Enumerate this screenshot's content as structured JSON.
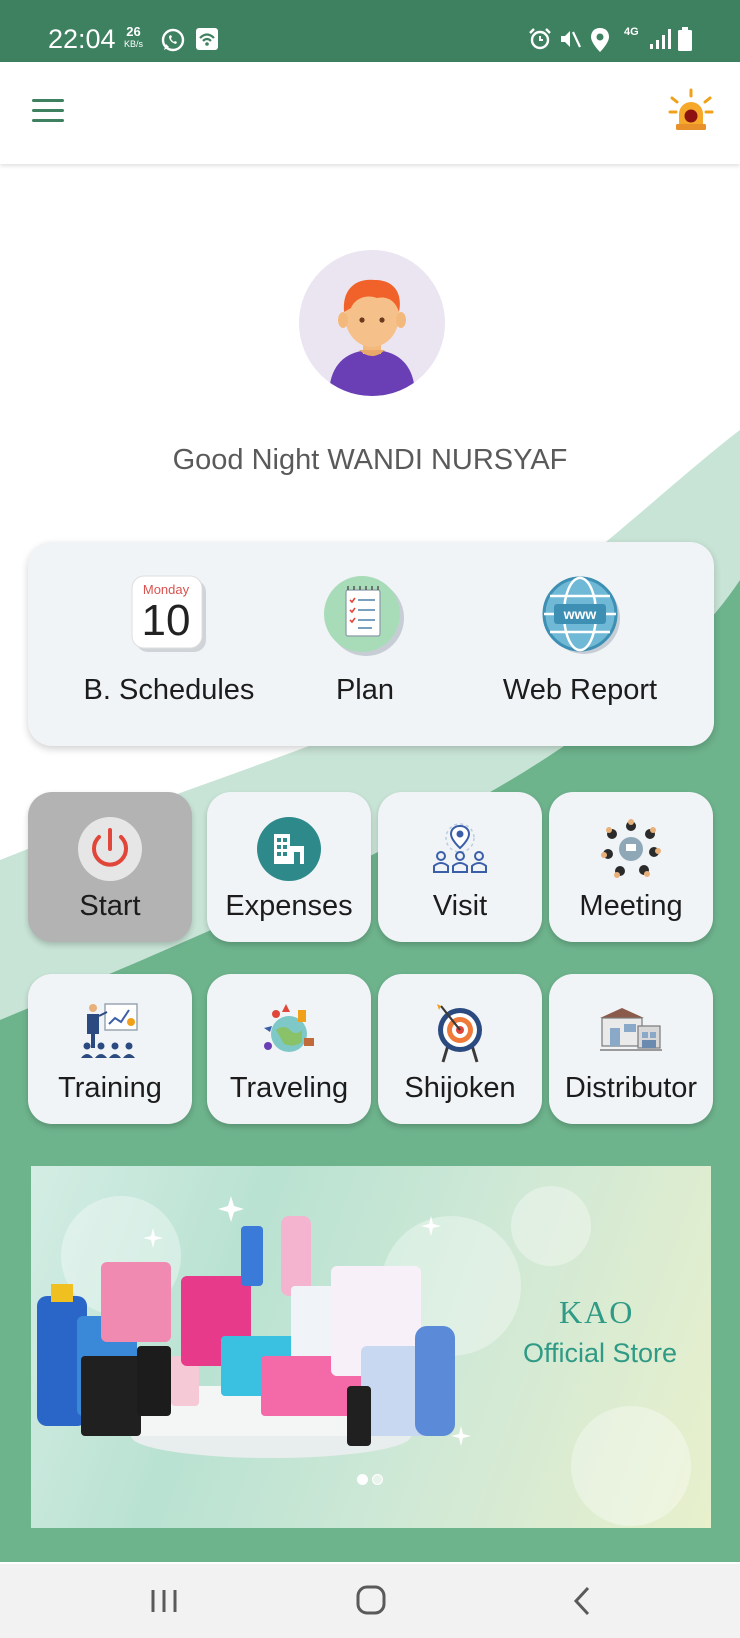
{
  "status_bar": {
    "time": "22:04",
    "speed_value": "26",
    "speed_unit": "KB/s",
    "network": "4G",
    "icons": [
      "whatsapp-icon",
      "wifi-call-icon",
      "alarm-icon",
      "mute-icon",
      "location-icon",
      "signal-icon",
      "battery-icon"
    ]
  },
  "app_bar": {
    "menu_icon": "hamburger-icon",
    "alert_icon": "alarm-light-icon"
  },
  "profile": {
    "greeting": "Good Night WANDI NURSYAF"
  },
  "quick_actions": [
    {
      "label": "B. Schedules",
      "calendar_day": "Monday",
      "calendar_date": "10",
      "icon": "calendar-icon"
    },
    {
      "label": "Plan",
      "icon": "checklist-icon"
    },
    {
      "label": "Web Report",
      "icon": "globe-www-icon"
    }
  ],
  "tiles": [
    {
      "label": "Start",
      "icon": "power-icon",
      "active": true
    },
    {
      "label": "Expenses",
      "icon": "building-icon"
    },
    {
      "label": "Visit",
      "icon": "visit-people-icon"
    },
    {
      "label": "Meeting",
      "icon": "meeting-table-icon"
    },
    {
      "label": "Training",
      "icon": "presentation-icon"
    },
    {
      "label": "Traveling",
      "icon": "travel-globe-icon"
    },
    {
      "label": "Shijoken",
      "icon": "target-icon"
    },
    {
      "label": "Distributor",
      "icon": "warehouse-icon"
    }
  ],
  "banner": {
    "brand": "KAO",
    "subtitle": "Official Store",
    "slide_count": 2,
    "active_slide": 1
  },
  "colors": {
    "primary": "#3e8160",
    "background_green": "#6db38c",
    "card": "#f1f4f7",
    "active_tile": "#b3b3b3",
    "brand_teal": "#2f9a86"
  }
}
